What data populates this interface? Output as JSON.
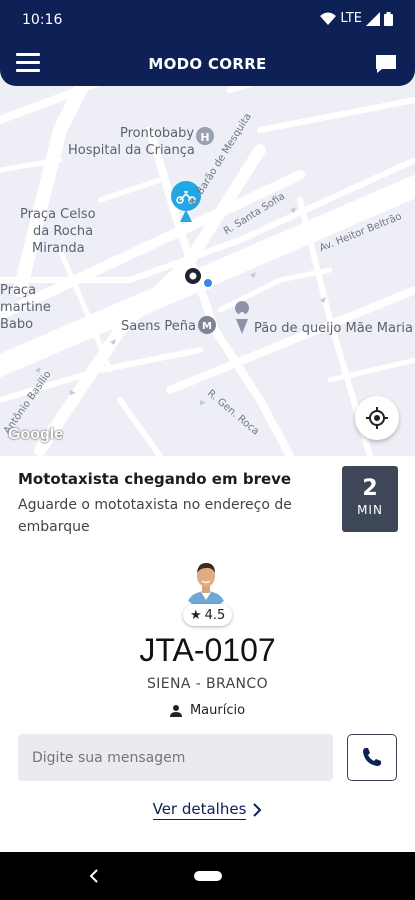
{
  "status_bar": {
    "time": "10:16",
    "network": "LTE"
  },
  "app_bar": {
    "title": "MODO CORRE"
  },
  "map": {
    "labels": {
      "prontobaby": "Prontobaby",
      "hospital": "Hospital da Criança",
      "praca_celso_1": "Praça Celso",
      "praca_celso_2": "da Rocha",
      "praca_celso_3": "Miranda",
      "praca_lamartine_1": "Praça",
      "praca_lamartine_2": "martine",
      "praca_lamartine_3": "Babo",
      "saens_pena": "Saens Peña",
      "pao_de_queijo": "Pão de queijo Mãe Maria"
    },
    "streets": {
      "barao_mesquita": "R. Barão de Mesquita",
      "santa_sofia": "R. Santa Sofia",
      "heitor_beltrao": "Av. Heitor Beltrão",
      "antonio_basilio": "Antônio Basílio",
      "gen_roca": "R. Gen. Roca"
    },
    "attribution": "Google"
  },
  "trip": {
    "title": "Mototaxista chegando em breve",
    "subtitle": "Aguarde o mototaxista no endereço de embarque",
    "eta_value": "2",
    "eta_unit": "MIN"
  },
  "driver": {
    "rating": "4.5",
    "plate": "JTA-0107",
    "car": "SIENA - BRANCO",
    "name": "Maurício"
  },
  "message": {
    "placeholder": "Digite sua mensagem"
  },
  "details_link": "Ver detalhes",
  "colors": {
    "primary": "#0d2157",
    "marker": "#22a7e3",
    "eta_bg": "#3e4757"
  }
}
